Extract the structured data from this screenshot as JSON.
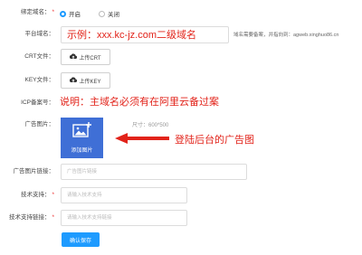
{
  "binding": {
    "label": "绑定域名：",
    "options": [
      {
        "label": "开启",
        "selected": true
      },
      {
        "label": "关闭",
        "selected": false
      }
    ]
  },
  "platform_domain": {
    "label": "平台域名：",
    "value": "示例：xxx.kc-jz.com二级域名",
    "hint": "域名需要备案，并指向到：agweb.xinghuo86.cn"
  },
  "crt": {
    "label": "CRT文件：",
    "button": "上传CRT"
  },
  "key": {
    "label": "KEY文件：",
    "button": "上传KEY"
  },
  "icp": {
    "label": "ICP备案号：",
    "note": "说明：主域名必须有在阿里云备过案"
  },
  "ad_image": {
    "label": "广告图片：",
    "add_label": "添加图片",
    "size_hint": "尺寸：600*500",
    "annotation": "登陆后台的广告图"
  },
  "ad_link": {
    "label": "广告图片链接：",
    "placeholder": "广告图片链接"
  },
  "tech_support": {
    "label": "技术支持：",
    "placeholder": "请输入技术支持"
  },
  "tech_support_link": {
    "label": "技术支持链接：",
    "placeholder": "请输入技术支持链接"
  },
  "submit": {
    "label": "确认保存"
  },
  "colors": {
    "accent": "#1e9bff",
    "upload_tile": "#3f6fd6",
    "annotation": "#e2231a"
  }
}
